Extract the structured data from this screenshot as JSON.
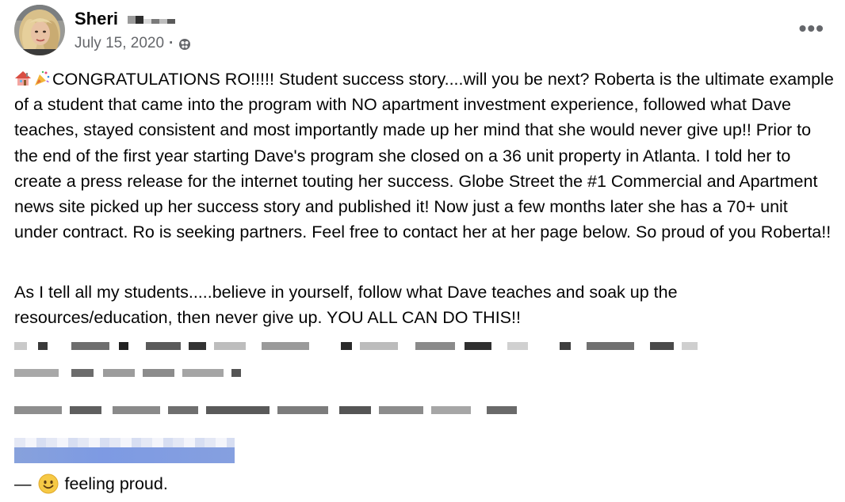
{
  "post": {
    "author_first": "Sheri",
    "date": "July 15, 2020",
    "separator": "·",
    "more_label": "•••",
    "icons": {
      "avatar": "profile-photo",
      "privacy": "globe-icon",
      "lead": [
        "house-icon",
        "party-popper-icon"
      ],
      "feeling": "smiling-face-icon"
    },
    "paragraph1": "CONGRATULATIONS RO!!!!! Student success story....will you be next? Roberta is the ultimate example of a student that came into the program with NO apartment investment experience, followed what Dave teaches, stayed consistent and most importantly made up her mind that she would never give up!! Prior to the end of the first year starting Dave's program she closed on a 36 unit property in Atlanta. I told her to create a press release for the internet touting her success. Globe Street the #1 Commercial and Apartment news site picked up her success story and published it! Now just a few months later she has a 70+ unit under contract. Ro is seeking partners. Feel free to contact her at her page below. So proud of you Roberta!!",
    "paragraph2": "As I tell all my students.....believe in yourself, follow what Dave teaches and soak up the resources/education, then never give up. YOU ALL CAN DO THIS!!",
    "feeling_prefix": "—",
    "feeling_text": "feeling proud."
  }
}
